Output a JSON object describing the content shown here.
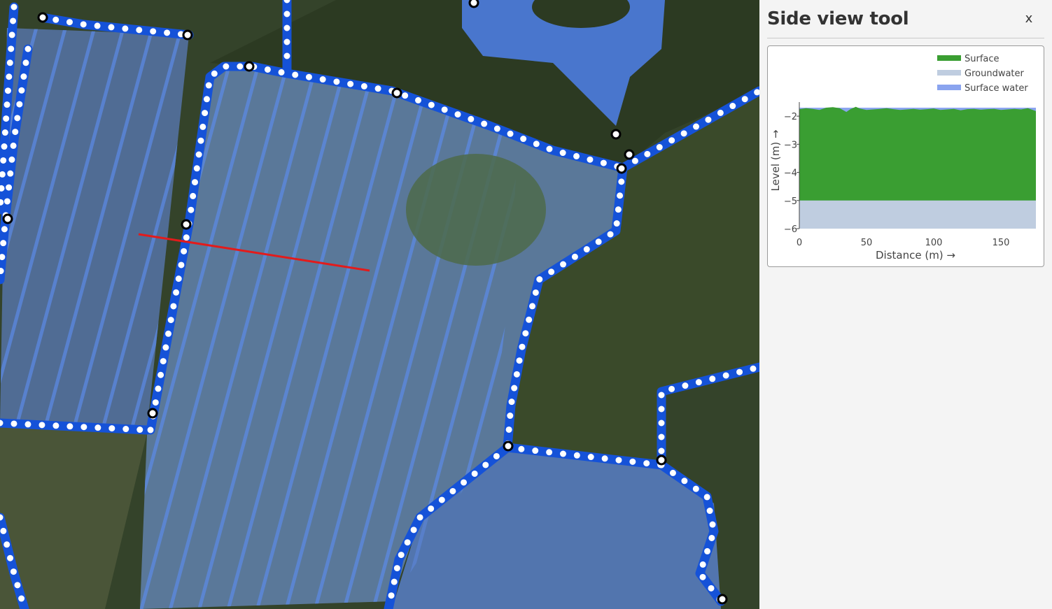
{
  "panel": {
    "title": "Side view tool",
    "close_label": "x"
  },
  "chart_data": {
    "type": "area",
    "xlabel": "Distance (m) →",
    "ylabel": "Level (m) →",
    "xlim": [
      0,
      176
    ],
    "ylim": [
      -6,
      -1.5
    ],
    "x_ticks": [
      "0",
      "50",
      "100",
      "150"
    ],
    "x_tick_values": [
      0,
      50,
      100,
      150
    ],
    "y_ticks": [
      "−2",
      "−3",
      "−4",
      "−5",
      "−6"
    ],
    "y_tick_values": [
      -2,
      -3,
      -4,
      -5,
      -6
    ],
    "legend_position": "top-right",
    "series": [
      {
        "name": "Surface",
        "color": "#3a9e32",
        "x": [
          0,
          5,
          10,
          15,
          20,
          25,
          30,
          35,
          38,
          42,
          45,
          50,
          55,
          60,
          65,
          70,
          75,
          80,
          85,
          90,
          95,
          100,
          105,
          110,
          115,
          120,
          125,
          130,
          135,
          140,
          145,
          150,
          155,
          160,
          165,
          170,
          176
        ],
        "y": [
          -1.75,
          -1.72,
          -1.74,
          -1.78,
          -1.7,
          -1.68,
          -1.72,
          -1.85,
          -1.75,
          -1.67,
          -1.73,
          -1.78,
          -1.76,
          -1.74,
          -1.72,
          -1.75,
          -1.78,
          -1.76,
          -1.74,
          -1.77,
          -1.75,
          -1.73,
          -1.78,
          -1.76,
          -1.74,
          -1.79,
          -1.75,
          -1.74,
          -1.77,
          -1.75,
          -1.74,
          -1.78,
          -1.76,
          -1.74,
          -1.76,
          -1.72,
          -1.82
        ]
      },
      {
        "name": "Groundwater",
        "color": "#bfcde0",
        "x": [
          0,
          176
        ],
        "y": [
          -5,
          -5
        ]
      },
      {
        "name": "Surface water",
        "color": "#8aa4ef",
        "x": [
          0,
          176
        ],
        "y": [
          -1.7,
          -1.7
        ]
      }
    ]
  }
}
